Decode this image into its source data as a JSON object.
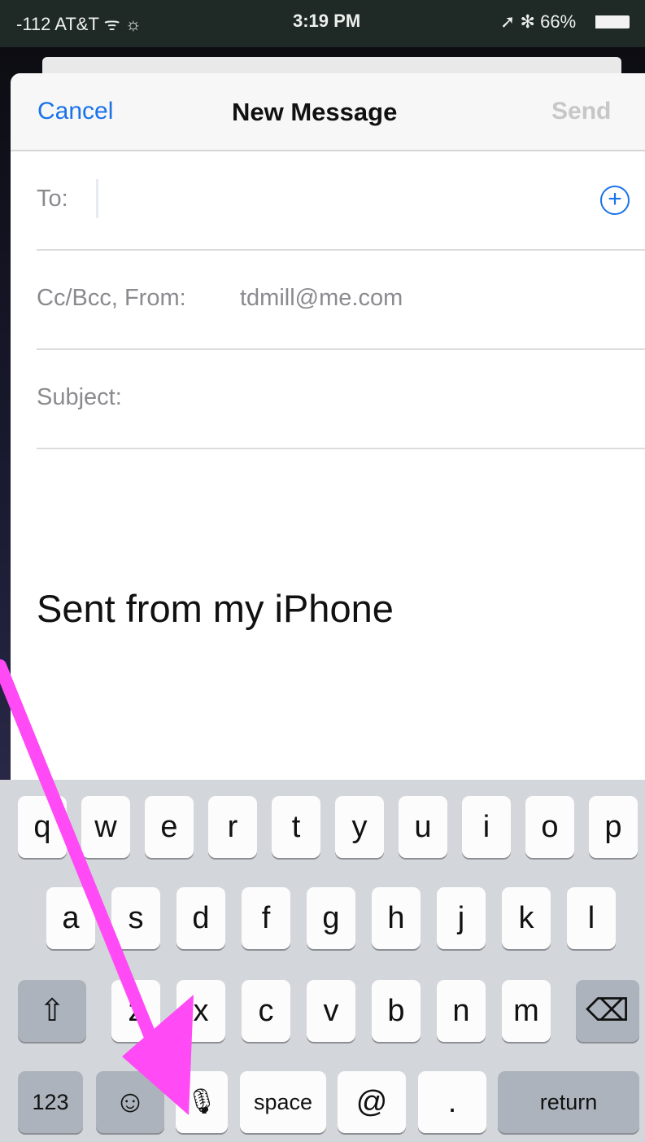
{
  "status_bar": {
    "carrier": "-112 AT&T ᯤ ☼",
    "time": "3:19 PM",
    "right": "➚ ✻ 66%"
  },
  "nav": {
    "cancel": "Cancel",
    "title": "New Message",
    "send": "Send"
  },
  "fields": {
    "to_label": "To:",
    "ccbcc_label": "Cc/Bcc, From:",
    "from_value": "tdmill@me.com",
    "subject_label": "Subject:"
  },
  "body": {
    "signature": "Sent from my iPhone"
  },
  "keyboard": {
    "row1": [
      "q",
      "w",
      "e",
      "r",
      "t",
      "y",
      "u",
      "i",
      "o",
      "p"
    ],
    "row2": [
      "a",
      "s",
      "d",
      "f",
      "g",
      "h",
      "j",
      "k",
      "l"
    ],
    "row3": [
      "z",
      "x",
      "c",
      "v",
      "b",
      "n",
      "m"
    ],
    "shift": "⇧",
    "delete": "⌫",
    "numbers": "123",
    "emoji": "☺",
    "mic": "🎙",
    "space": "space",
    "at": "@",
    "period": ".",
    "return": "return"
  },
  "colors": {
    "accent": "#1a73e8",
    "annotation_arrow": "#ff4af5"
  }
}
